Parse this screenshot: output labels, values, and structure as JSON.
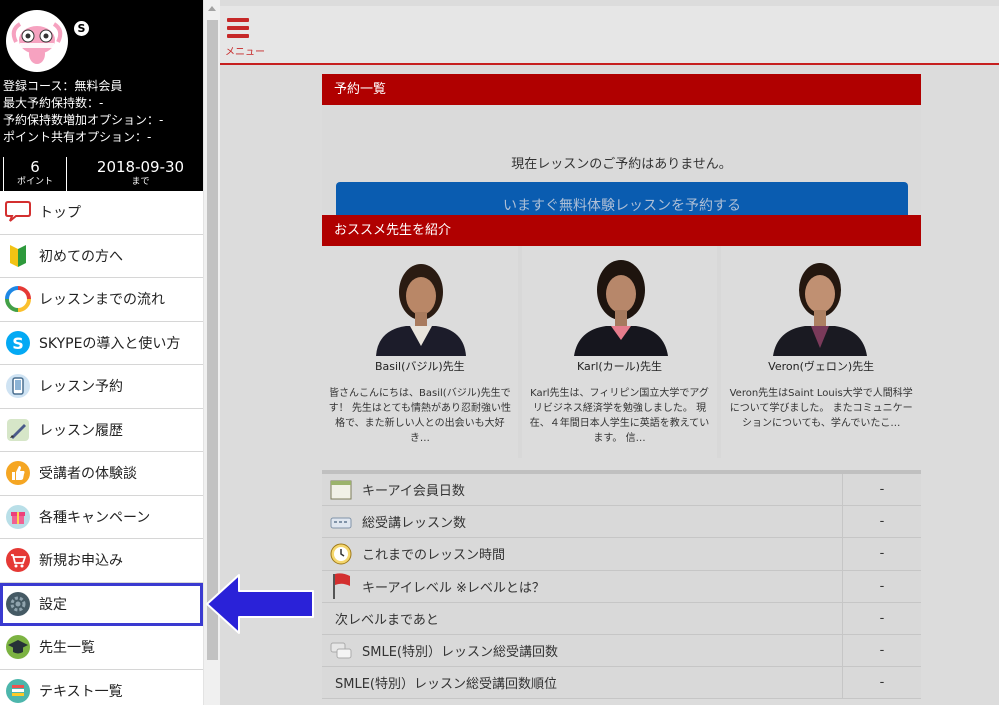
{
  "profile": {
    "skype_badge": "S",
    "course": "登録コース：無料会員",
    "max_reservations": "最大予約保持数：-",
    "reservation_option": "予約保持数増加オプション：-",
    "point_share_option": "ポイント共有オプション：-",
    "points_value": "6",
    "points_unit": "ポイント",
    "expiry_date": "2018-09-30",
    "expiry_unit": "まで"
  },
  "menu": {
    "items": [
      {
        "label": "トップ",
        "icon": "speech-bubble-icon"
      },
      {
        "label": "初めての方へ",
        "icon": "beginner-mark-icon"
      },
      {
        "label": "レッスンまでの流れ",
        "icon": "cycle-arrows-icon"
      },
      {
        "label": "SKYPEの導入と使い方",
        "icon": "skype-icon"
      },
      {
        "label": "レッスン予約",
        "icon": "phone-icon"
      },
      {
        "label": "レッスン履歴",
        "icon": "pencil-chart-icon"
      },
      {
        "label": "受講者の体験談",
        "icon": "thumbs-up-icon"
      },
      {
        "label": "各種キャンペーン",
        "icon": "gift-icon"
      },
      {
        "label": "新規お申込み",
        "icon": "cart-icon"
      },
      {
        "label": "設定",
        "icon": "gear-icon"
      },
      {
        "label": "先生一覧",
        "icon": "graduation-cap-icon"
      },
      {
        "label": "テキスト一覧",
        "icon": "books-icon"
      }
    ]
  },
  "topbar": {
    "menu_label": "メニュー"
  },
  "reservation": {
    "title": "予約一覧",
    "empty_message": "現在レッスンのご予約はありません。",
    "book_button": "いますぐ無料体験レッスンを予約する"
  },
  "recommend": {
    "title": "おススメ先生を紹介",
    "teachers": [
      {
        "name": "Basil(バジル)先生",
        "desc": "皆さんこんにちは、Basil(バジル)先生です！ 先生はとても情熱があり忍耐強い性格で、また新しい人との出会いも大好き…"
      },
      {
        "name": "Karl(カール)先生",
        "desc": "Karl先生は、フィリピン国立大学でアグリビジネス経済学を勉強しました。 現在、４年間日本人学生に英語を教えています。 信…"
      },
      {
        "name": "Veron(ヴェロン)先生",
        "desc": "Veron先生はSaint Louis大学で人間科学について学びました。 またコミュニケーションについても、学んでいたこ…"
      }
    ]
  },
  "stats": {
    "rows": [
      {
        "label": "キーアイ会員日数",
        "value": "-",
        "icon": "calendar-icon"
      },
      {
        "label": "総受講レッスン数",
        "value": "-",
        "icon": "keyboard-icon"
      },
      {
        "label": "これまでのレッスン時間",
        "value": "-",
        "icon": "clock-icon"
      },
      {
        "label": "キーアイレベル ※レベルとは？",
        "value": "-",
        "icon": "red-flag-icon"
      },
      {
        "label": "次レベルまであと",
        "value": "-",
        "icon": ""
      },
      {
        "label": "SMLE(特別）レッスン総受講回数",
        "value": "-",
        "icon": "chat-bubbles-icon"
      },
      {
        "label": "SMLE(特別）レッスン総受講回数順位",
        "value": "-",
        "icon": ""
      }
    ]
  },
  "colors": {
    "accent_red": "#b00000",
    "button_blue": "#0a5cb0",
    "highlight_border": "#3a3ad0",
    "arrow_blue": "#2a22d8"
  }
}
